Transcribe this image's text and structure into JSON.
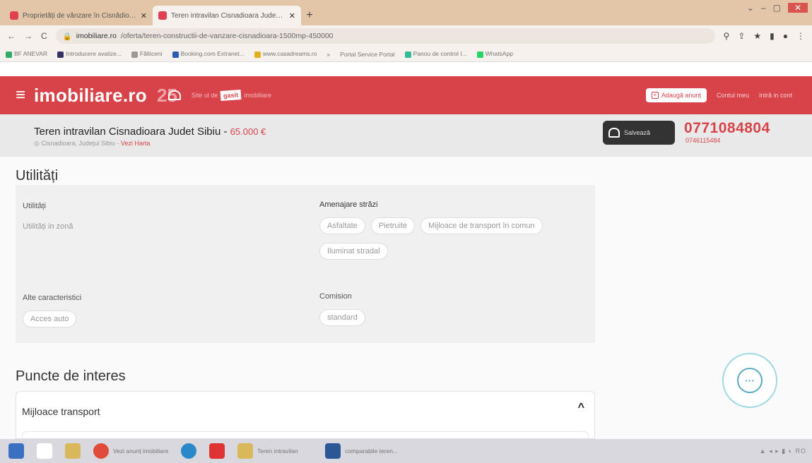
{
  "browser": {
    "tabs": [
      {
        "title": "Proprietăți de vânzare în Cisnădioara",
        "active": false
      },
      {
        "title": "Teren intravilan Cisnadioara Judet Sibiu",
        "active": true
      }
    ],
    "new_tab": "+",
    "url_host": "imobiliare.ro",
    "url_path": "/oferta/teren-constructii-de-vanzare-cisnadioara-1500mp-450000",
    "bookmarks": [
      "BF ANEVAR",
      "Introducere avalize...",
      "Fălticeni",
      "Booking.com Extranet...",
      "www.casadreams.ro",
      "»",
      "Portal Service Portal",
      "Panou de control I...",
      "WhatsApp"
    ]
  },
  "site": {
    "logo": "imobiliare.ro",
    "anniversary": "25",
    "tagline_pre": "Site ul de",
    "tagline_highlight": "gasit",
    "tagline_post": "imobiliare",
    "add_listing": "Adaugă anunț",
    "contact": "Contul meu",
    "login": "Intră in cont"
  },
  "listing": {
    "title": "Teren intravilan Cisnadioara Judet Sibiu - ",
    "price": "65.000 €",
    "location": "Cisnadioara, Judeţul Sibiu - ",
    "map_link": "Vezi Harta",
    "save_label": "Salvează",
    "phone": "0771084804",
    "phone_secondary": "0746115484"
  },
  "utilities": {
    "section_title": "Utilități",
    "col1_title": "Utilități",
    "col1_items": [
      "Utilități in zonă"
    ],
    "col2_title": "Amenajare străzi",
    "col2_items": [
      "Asfaltate",
      "Pietruite",
      "Mijloace de transport în comun",
      "Iluminat stradal"
    ],
    "col3_title": "Alte caracteristici",
    "col3_items": [
      "Acces auto"
    ],
    "col4_title": "Comision",
    "col4_items": [
      "standard"
    ]
  },
  "poi": {
    "section_title": "Puncte de interes",
    "accordion_label": "Mijloace transport",
    "chevron": "^"
  },
  "taskbar": {
    "items": [
      "Vezi anunț imobiliare",
      "",
      "",
      "Teren intravilan",
      "comparabile teren..."
    ],
    "tray": "▲ ◂ ▸ ▮ ◐ RO"
  },
  "colors": {
    "brand": "#d8434a",
    "save_bg": "#333333",
    "chat_accent": "#5aa9c0"
  }
}
